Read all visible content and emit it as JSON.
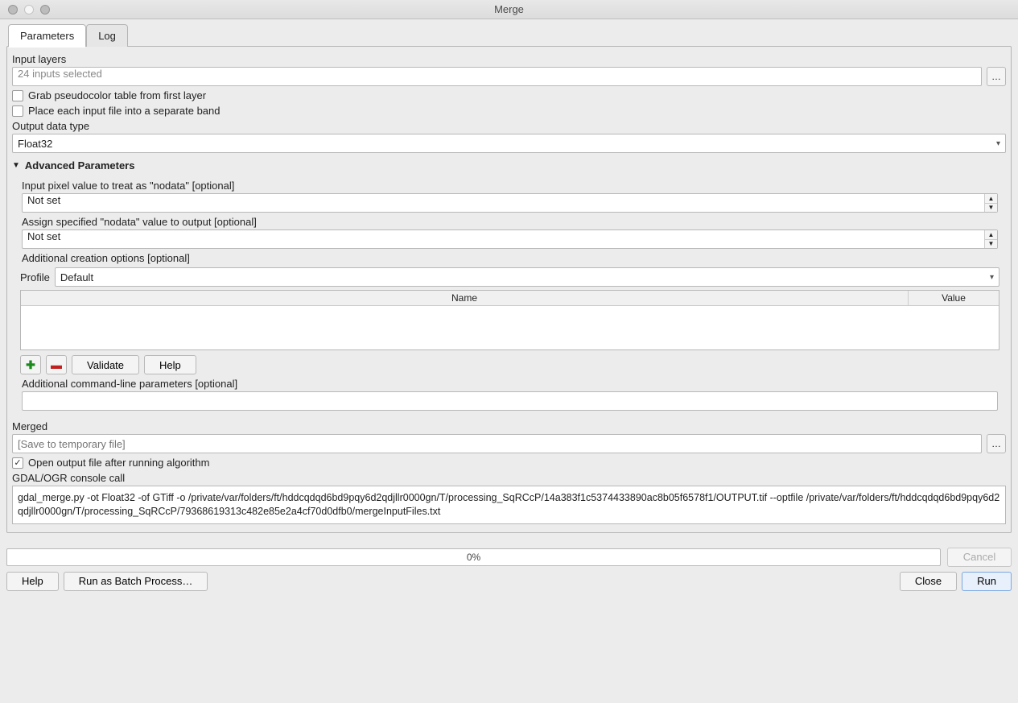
{
  "window": {
    "title": "Merge"
  },
  "tabs": {
    "parameters": "Parameters",
    "log": "Log"
  },
  "inputLayers": {
    "label": "Input layers",
    "value": "24 inputs selected",
    "browse": "…"
  },
  "chk1": {
    "label": "Grab pseudocolor table from first layer",
    "checked": false
  },
  "chk2": {
    "label": "Place each input file into a separate band",
    "checked": false
  },
  "outputDataType": {
    "label": "Output data type",
    "value": "Float32"
  },
  "advanced": {
    "header": "Advanced Parameters",
    "nodataIn": {
      "label": "Input pixel value to treat as \"nodata\" [optional]",
      "value": "Not set"
    },
    "nodataOut": {
      "label": "Assign specified \"nodata\" value to output [optional]",
      "value": "Not set"
    },
    "creationOpts": {
      "label": "Additional creation options [optional]"
    },
    "profile": {
      "label": "Profile",
      "value": "Default"
    },
    "tableHeaders": {
      "name": "Name",
      "value": "Value"
    },
    "buttons": {
      "validate": "Validate",
      "help": "Help"
    },
    "cmdline": {
      "label": "Additional command-line parameters [optional]",
      "value": ""
    }
  },
  "merged": {
    "label": "Merged",
    "placeholder": "[Save to temporary file]",
    "browse": "…"
  },
  "openOutput": {
    "label": "Open output file after running algorithm",
    "checked": true
  },
  "console": {
    "label": "GDAL/OGR console call",
    "value": "gdal_merge.py -ot Float32 -of GTiff -o /private/var/folders/ft/hddcqdqd6bd9pqy6d2qdjllr0000gn/T/processing_SqRCcP/14a383f1c5374433890ac8b05f6578f1/OUTPUT.tif --optfile /private/var/folders/ft/hddcqdqd6bd9pqy6d2qdjllr0000gn/T/processing_SqRCcP/79368619313c482e85e2a4cf70d0dfb0/mergeInputFiles.txt"
  },
  "progress": {
    "text": "0%",
    "cancel": "Cancel"
  },
  "bottom": {
    "help": "Help",
    "batch": "Run as Batch Process…",
    "close": "Close",
    "run": "Run"
  }
}
